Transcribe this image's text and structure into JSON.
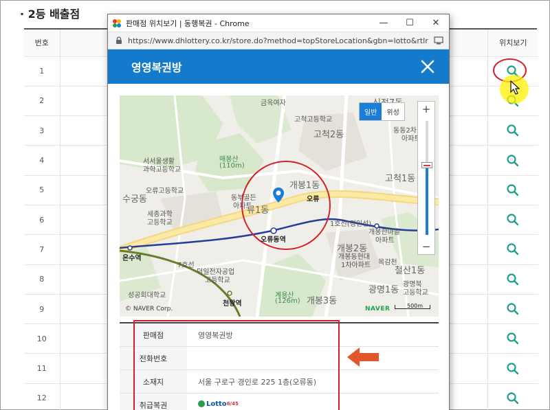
{
  "page": {
    "section_title": "· 2등 배출점",
    "columns": {
      "no": "번호",
      "map": "위치보기"
    },
    "rows": [
      "1",
      "2",
      "3",
      "4",
      "5",
      "6",
      "7",
      "8",
      "9",
      "10",
      "11",
      "12"
    ]
  },
  "popup": {
    "window_title": "판매점 위치보기 | 동행복권 - Chrome",
    "url": "https://www.dhlottery.co.kr/store.do?method=topStoreLocation&gbn=lotto&rtlrld=",
    "store_name": "영영복권방",
    "close_icon": "close-icon",
    "map": {
      "toggle_normal": "일반",
      "toggle_satellite": "위성",
      "zoom_in": "+",
      "zoom_out": "−",
      "copyright": "© NAVER Corp.",
      "naver": "NAVER",
      "scale": "500m",
      "labels": {
        "geumgwang": "금옥여자",
        "gocheok_high": "고척고등학교",
        "gocheok2": "고척2동",
        "maebong": "매봉산",
        "maebong_h": "(110m)",
        "seoseoul": "서서울생활",
        "seoseoul2": "과학고등학교",
        "sugung": "수궁동",
        "oryu_high": "오류고등학교",
        "sejong": "세종과학",
        "sejong2": "고등학교",
        "dongbu": "동부골든",
        "dongbu2": "아파트",
        "ryu1": "류1동",
        "gaebong1": "개봉1동",
        "oryu_ic": "오류",
        "gocheok1": "고척1동",
        "line1": "1호선(경인선)",
        "oryudong_station": "오류동역",
        "onsu": "온수역",
        "line7": "7호선",
        "deogil": "덕일전자공업",
        "deogil2": "고등학교",
        "sunggonghoe": "성공회대학교",
        "gaebong2": "개봉2동",
        "gaebong_hyundai": "개봉동현대",
        "gaebong_hyundai2": "1차아파트",
        "gaeung": "계용산",
        "gaeung_h": "(126m)",
        "gaebong3": "개봉3동",
        "gwangmyeong": "광명1동",
        "cheonwang": "천왕역",
        "cheolsan": "철산1동",
        "sinjeong": "신정7동",
        "gaebong_hanmaeul": "개봉한마을",
        "gaebong_hanmaeul2": "아파트",
        "mokgam": "목감천",
        "gwangmyeongbuk": "광명북",
        "gwangmyeongbuk2": "고등학교",
        "bundong": "동동2차",
        "apartment": "아파트"
      }
    },
    "info": {
      "store_label": "판매점",
      "store_value": "영영복권방",
      "phone_label": "전화번호",
      "phone_value": "",
      "address_label": "소재지",
      "address_value": "서울 구로구 경인로 225 1층(오류동)",
      "products_label": "취급복권",
      "products_value": "Lotto",
      "products_suffix": "6/45"
    }
  },
  "colors": {
    "header_blue": "#137acc",
    "highlight_red": "#d41e2a",
    "arrow_orange": "#e0562a",
    "icon_teal": "#1f9e8a"
  }
}
